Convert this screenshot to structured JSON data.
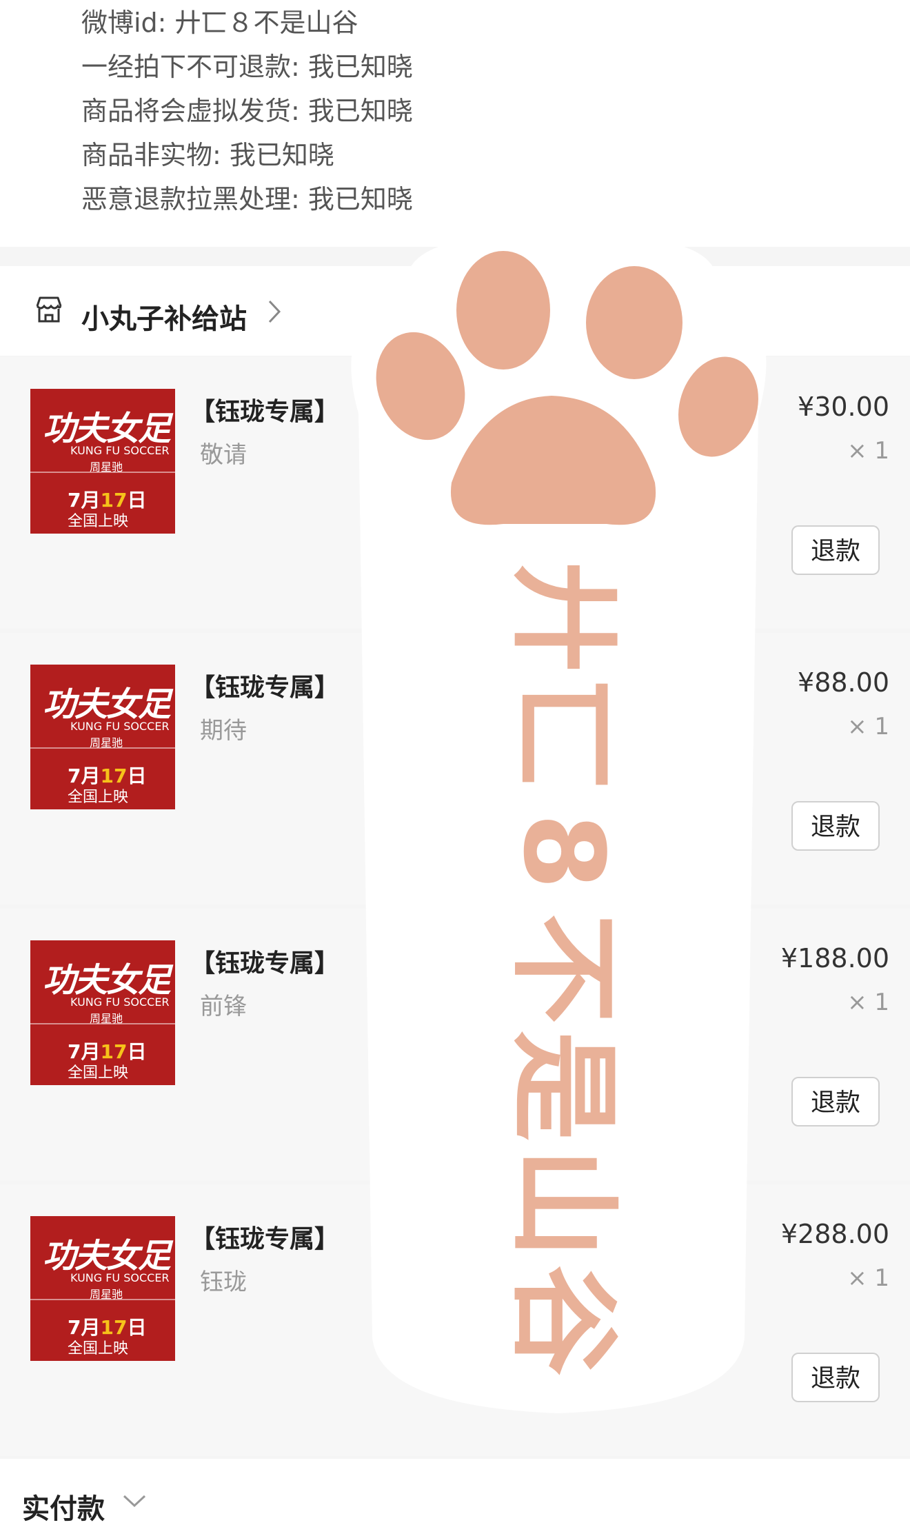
{
  "notes": [
    "微博id: 廾匸８不是山谷",
    "一经拍下不可退款: 我已知晓",
    "商品将会虚拟发货: 我已知晓",
    "商品非实物: 我已知晓",
    "恶意退款拉黑处理: 我已知晓"
  ],
  "shop": {
    "name": "小丸子补给站"
  },
  "thumbnail": {
    "title": "功夫女足",
    "subtitle": "KUNG FU SOCCER",
    "director": "周星驰",
    "date_prefix": "7月",
    "date_num": "17",
    "date_suffix": "日",
    "release": "全国上映"
  },
  "items": [
    {
      "title": "【钰珑专属】",
      "spec": "敬请",
      "price": "¥30.00",
      "qty": "× 1",
      "refund_label": "退款"
    },
    {
      "title": "【钰珑专属】",
      "spec": "期待",
      "price": "¥88.00",
      "qty": "× 1",
      "refund_label": "退款"
    },
    {
      "title": "【钰珑专属】",
      "spec": "前锋",
      "price": "¥188.00",
      "qty": "× 1",
      "refund_label": "退款"
    },
    {
      "title": "【钰珑专属】",
      "spec": "钰珑",
      "price": "¥288.00",
      "qty": "× 1",
      "refund_label": "退款"
    }
  ],
  "footer": {
    "label": "实付款"
  },
  "watermark": {
    "chars": [
      "廾",
      "匸",
      "8",
      "不",
      "是",
      "山",
      "谷"
    ]
  },
  "colors": {
    "watermark": "#e8ad93",
    "thumb_bg": "#b21e1e"
  }
}
